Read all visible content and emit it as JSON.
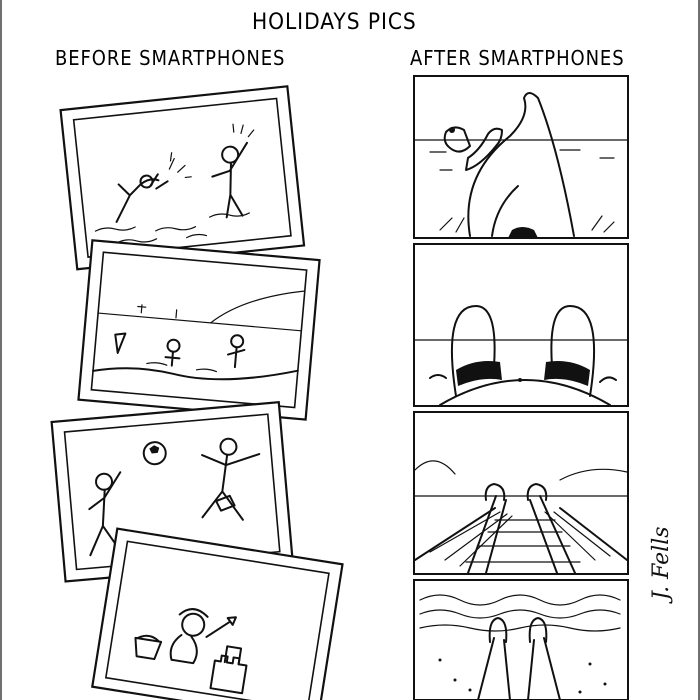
{
  "comic": {
    "title": "HOLIDAYS PICS",
    "left_heading": "BEFORE SMARTPHONES",
    "right_heading": "AFTER SMARTPHONES",
    "signature": "J. Fells"
  },
  "colors": {
    "ink": "#111111",
    "paper": "#ffffff"
  },
  "left_photos": [
    {
      "scene": "two people splashing water in the sea"
    },
    {
      "scene": "people playing in the sea near the shore"
    },
    {
      "scene": "two people playing with a ball on the beach"
    },
    {
      "scene": "child building a sandcastle"
    }
  ],
  "right_panels": [
    {
      "scene": "crossed legs over the sea"
    },
    {
      "scene": "bent knees and belly on the beach"
    },
    {
      "scene": "feet on a wooden pier"
    },
    {
      "scene": "feet on the sand by the waves"
    }
  ]
}
